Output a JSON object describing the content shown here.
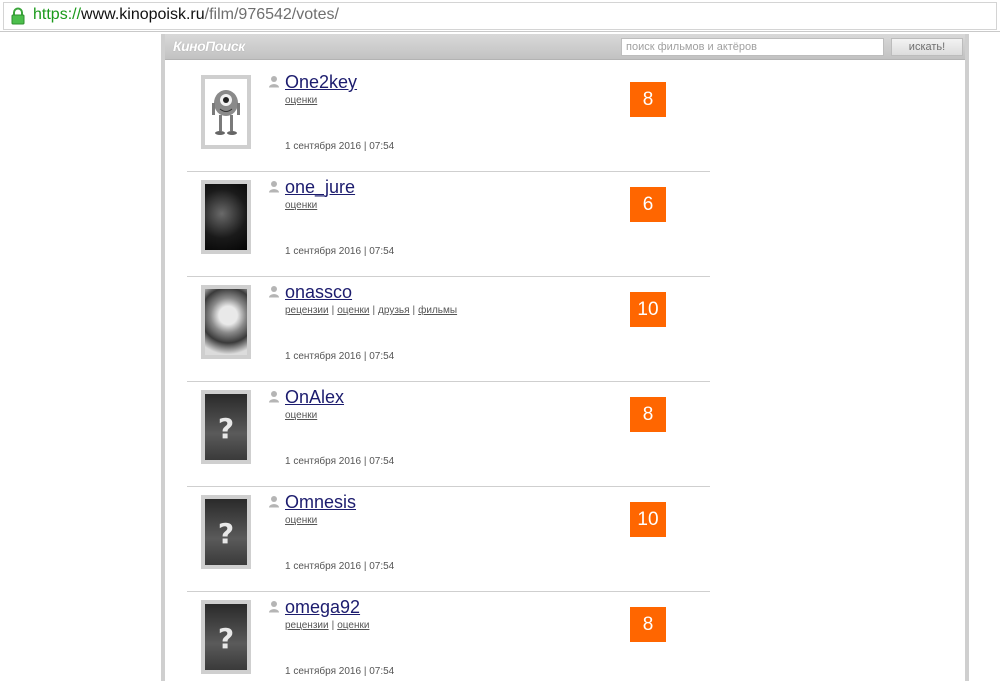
{
  "browser": {
    "url_scheme": "https://",
    "url_host": "www.kinopoisk.ru",
    "url_path": "/film/976542/votes/"
  },
  "site": {
    "logo": "КиноПоиск",
    "search_placeholder": "поиск фильмов и актёров",
    "search_button": "искать!"
  },
  "votes": [
    {
      "username": "One2key",
      "links": [
        "оценки"
      ],
      "date": "1 сентября 2016 | 07:54",
      "score": "8",
      "avatar": "p1"
    },
    {
      "username": "one_jure",
      "links": [
        "оценки"
      ],
      "date": "1 сентября 2016 | 07:54",
      "score": "6",
      "avatar": "p2"
    },
    {
      "username": "onassco",
      "links": [
        "рецензии",
        "оценки",
        "друзья",
        "фильмы"
      ],
      "date": "1 сентября 2016 | 07:54",
      "score": "10",
      "avatar": "p3"
    },
    {
      "username": "OnAlex",
      "links": [
        "оценки"
      ],
      "date": "1 сентября 2016 | 07:54",
      "score": "8",
      "avatar": "q"
    },
    {
      "username": "Omnesis",
      "links": [
        "оценки"
      ],
      "date": "1 сентября 2016 | 07:54",
      "score": "10",
      "avatar": "q"
    },
    {
      "username": "omega92",
      "links": [
        "рецензии",
        "оценки"
      ],
      "date": "1 сентября 2016 | 07:54",
      "score": "8",
      "avatar": "q"
    }
  ],
  "placeholder_avatar_glyph": "?",
  "colors": {
    "score_bg": "#ff6600",
    "link": "#1c1c6e",
    "secure_green": "#1a9a1a"
  }
}
